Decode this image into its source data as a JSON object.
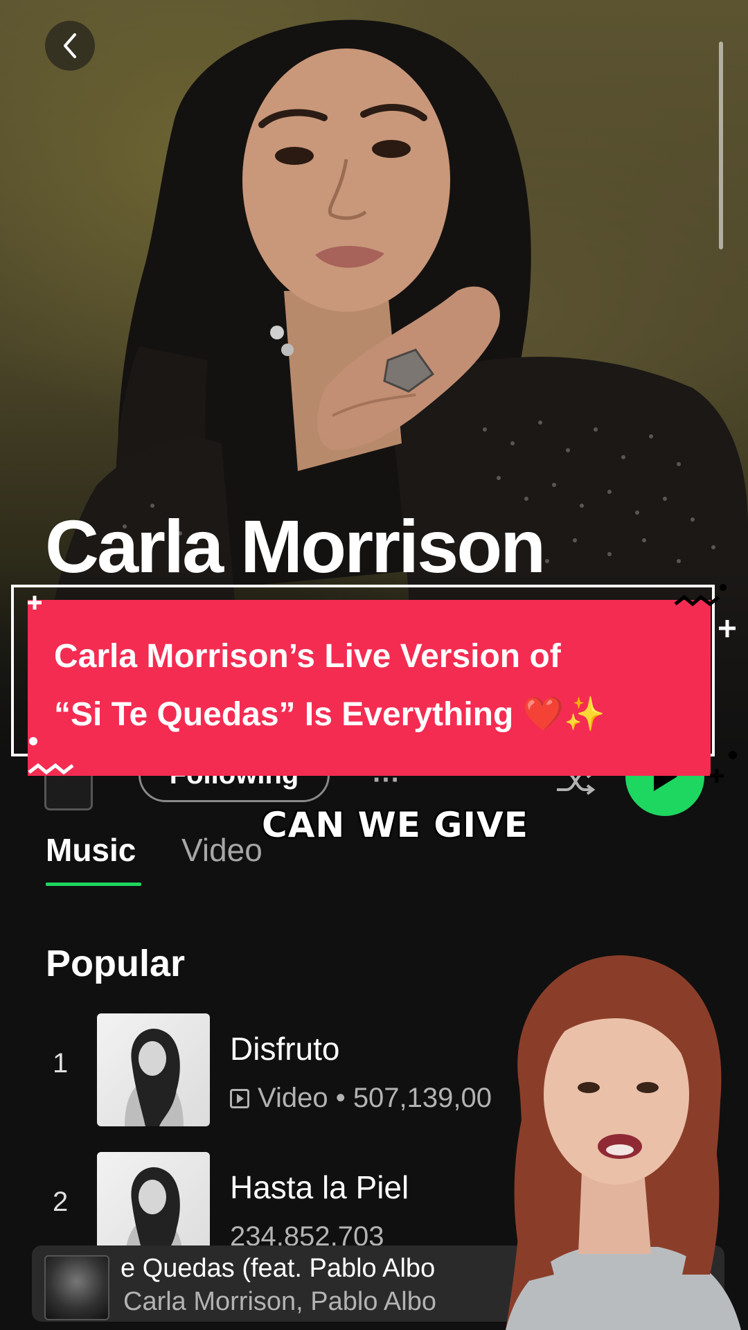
{
  "artist": {
    "name": "Carla Morrison"
  },
  "banner": {
    "line1": "Carla Morrison’s Live Version of",
    "line2": "“Si Te Quedas” Is Everything ❤️✨"
  },
  "controls": {
    "following_label": "Following",
    "more_label": "···"
  },
  "caption": "CAN WE GIVE",
  "tabs": [
    {
      "label": "Music",
      "active": true
    },
    {
      "label": "Video",
      "active": false
    }
  ],
  "popular": {
    "title": "Popular",
    "tracks": [
      {
        "rank": "1",
        "title": "Disfruto",
        "meta": "Video • 507,139,00"
      },
      {
        "rank": "2",
        "title": "Hasta la Piel",
        "meta": "234,852,703"
      }
    ]
  },
  "now_playing": {
    "title": "e Quedas (feat. Pablo Albo",
    "artists": "Carla Morrison, Pablo Albo"
  },
  "colors": {
    "accent_green": "#1ed760",
    "banner_red": "#f42c52",
    "background": "#101010"
  }
}
